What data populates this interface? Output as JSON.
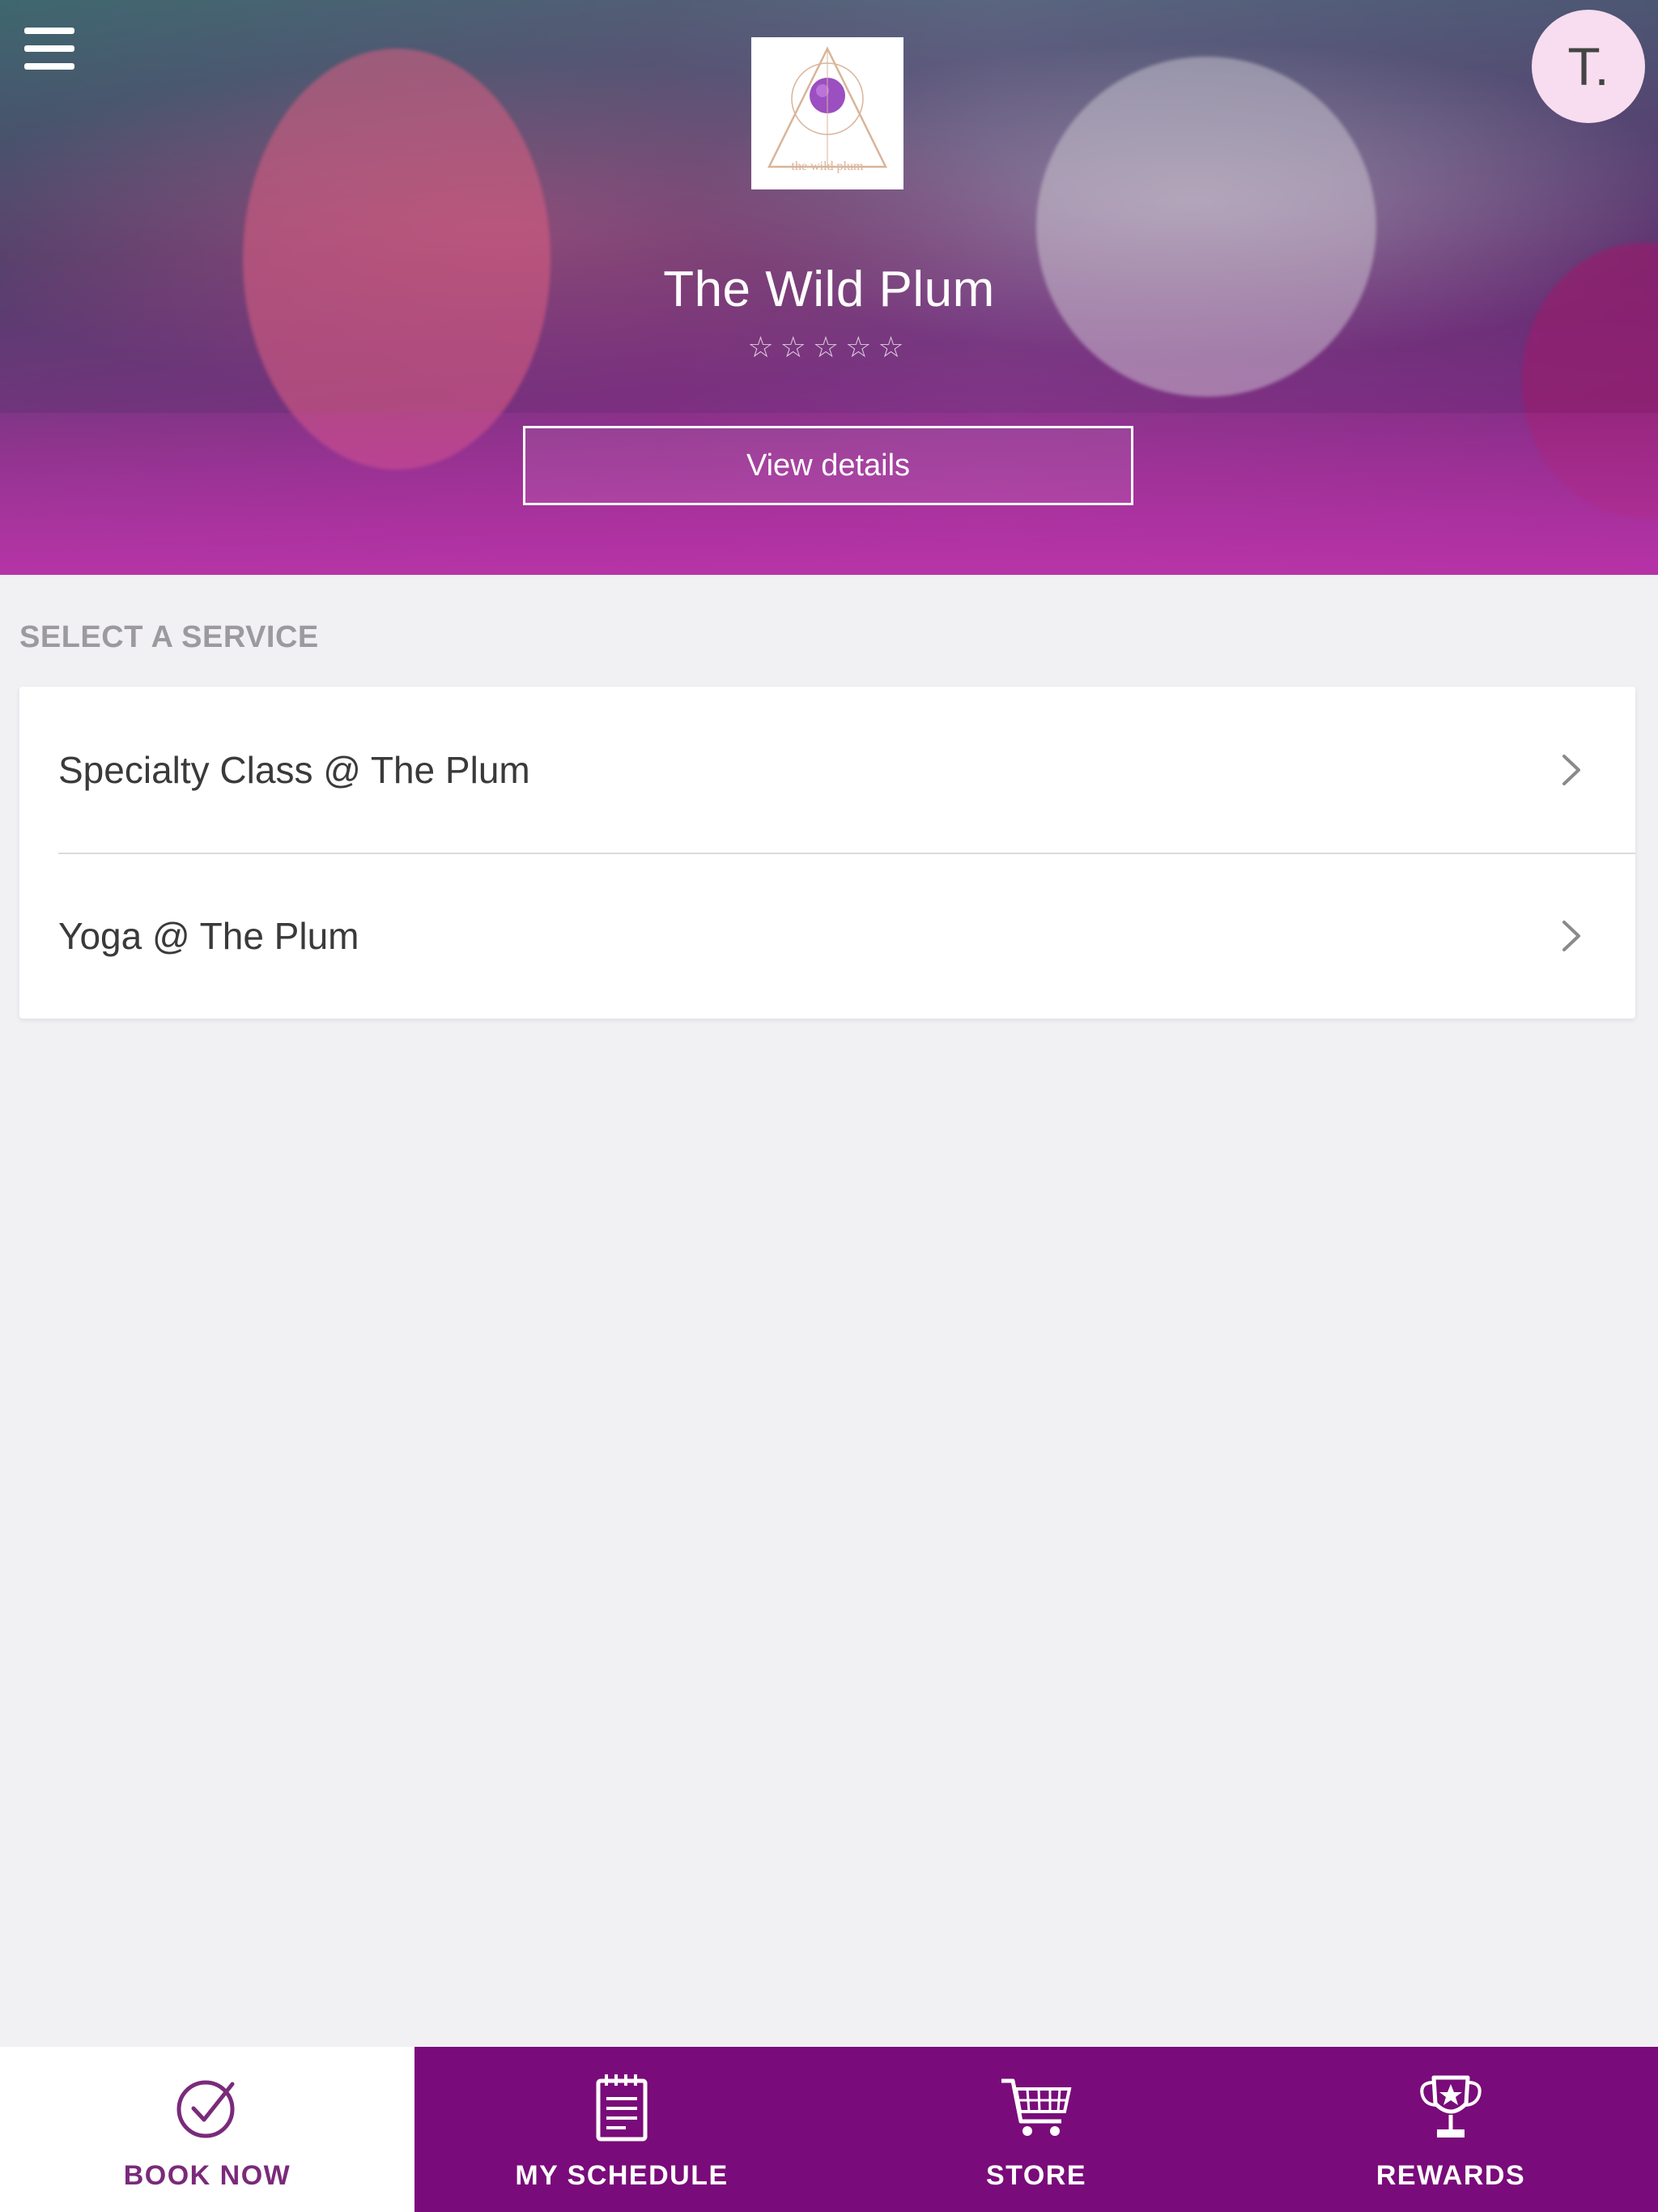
{
  "header": {
    "studio_name": "The Wild Plum",
    "rating_stars": "☆☆☆☆☆",
    "rating_value": 0,
    "view_details_label": "View details",
    "avatar_initial": "T.",
    "logo_text": "the wild plum"
  },
  "services": {
    "section_title": "SELECT A SERVICE",
    "items": [
      {
        "label": "Specialty Class @ The Plum"
      },
      {
        "label": "Yoga @ The Plum"
      }
    ]
  },
  "bottom_nav": {
    "items": [
      {
        "label": "BOOK NOW",
        "icon": "check-circle-icon",
        "active": true
      },
      {
        "label": "MY SCHEDULE",
        "icon": "calendar-icon",
        "active": false
      },
      {
        "label": "STORE",
        "icon": "cart-icon",
        "active": false
      },
      {
        "label": "REWARDS",
        "icon": "trophy-icon",
        "active": false
      }
    ]
  },
  "colors": {
    "brand_purple": "#7a0b7a",
    "background": "#f1f0f3",
    "avatar_bg": "#f8dcef",
    "section_title": "#9c9a9f"
  }
}
